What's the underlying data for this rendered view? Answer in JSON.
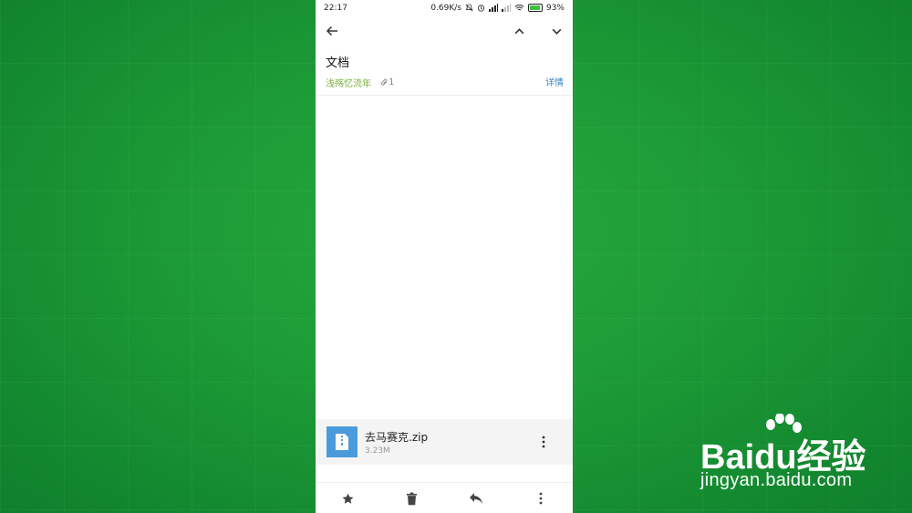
{
  "status_bar": {
    "time": "22:17",
    "speed": "0.69K/s",
    "battery": "93%"
  },
  "email": {
    "subject": "文档",
    "sender": "浅殇忆流年",
    "attachment_count": "1",
    "details_label": "详情"
  },
  "attachment": {
    "filename": "去马赛克.zip",
    "size": "3.23M"
  },
  "watermark": {
    "logo": "Baidu经验",
    "url": "jingyan.baidu.com"
  },
  "colors": {
    "background": "#1c9a36",
    "sender": "#7ab03c",
    "link": "#3b84c4",
    "file_icon": "#4a9bdc"
  }
}
